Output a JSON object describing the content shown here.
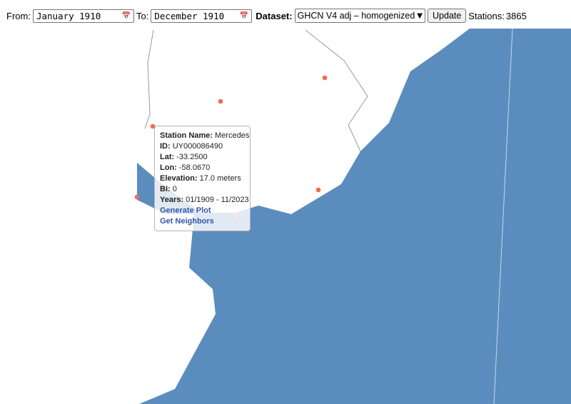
{
  "controls": {
    "from_label": "From:",
    "from_value": "January 1910",
    "to_label": "To:",
    "to_value": "December 1910",
    "dataset_label": "Dataset:",
    "dataset_value": "GHCN V4 adj – homogenized",
    "update_label": "Update",
    "stations_label": "Stations:",
    "stations_count": "3865"
  },
  "map": {
    "ocean_color": "#5a8dbd",
    "land_color": "#ffffff",
    "border_color": "#999999",
    "station_color": "#f26b4f",
    "stations_visible": 7
  },
  "popup": {
    "station_name_label": "Station Name:",
    "station_name": "Mercedes",
    "id_label": "ID:",
    "id": "UY000086490",
    "lat_label": "Lat:",
    "lat": "-33.2500",
    "lon_label": "Lon:",
    "lon": "-58.0670",
    "elevation_label": "Elevation:",
    "elevation": "17.0 meters",
    "bi_label": "BI:",
    "bi": "0",
    "years_label": "Years:",
    "years": "01/1909 - 11/2023",
    "generate_plot": "Generate Plot",
    "get_neighbors": "Get Neighbors"
  }
}
